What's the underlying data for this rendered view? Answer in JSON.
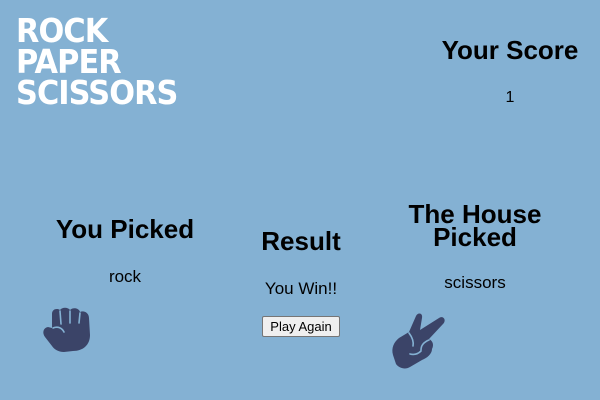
{
  "logo": {
    "line1": "ROCK",
    "line2": "PAPER",
    "line3": "SCISSORS"
  },
  "score": {
    "title": "Your Score",
    "value": "1"
  },
  "player": {
    "heading": "You Picked",
    "choice": "rock",
    "icon": "rock-hand-icon"
  },
  "result": {
    "heading": "Result",
    "text": "You Win!!",
    "play_again_label": "Play Again"
  },
  "house": {
    "heading": "The House Picked",
    "choice": "scissors",
    "icon": "scissors-hand-icon"
  },
  "colors": {
    "background": "#84b1d3",
    "hand": "#3b4468",
    "logo": "#ffffff"
  }
}
